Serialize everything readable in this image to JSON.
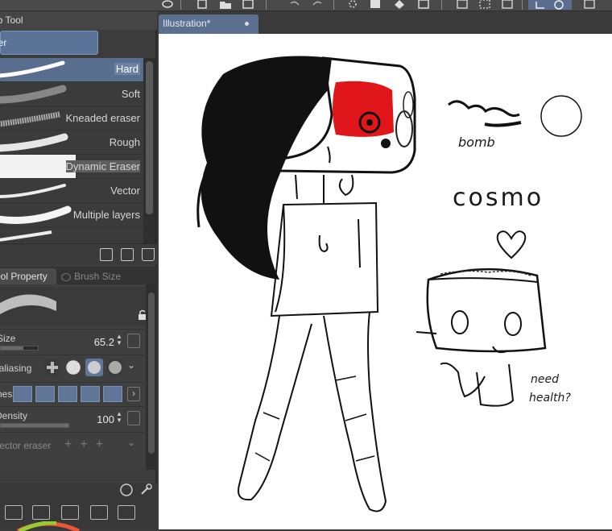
{
  "subtool_panel": {
    "title": "Sub Tool",
    "group_label": "Eraser",
    "brushes": [
      {
        "label": "Hard",
        "selected": true
      },
      {
        "label": "Soft",
        "selected": false
      },
      {
        "label": "Kneaded eraser",
        "selected": false
      },
      {
        "label": "Rough",
        "selected": false
      },
      {
        "label": "Dynamic Eraser",
        "selected": false
      },
      {
        "label": "Vector",
        "selected": false
      },
      {
        "label": "Multiple layers",
        "selected": false
      }
    ]
  },
  "property_tabs": {
    "tool_property": "Tool Property",
    "brush_size": "Brush Size"
  },
  "properties": {
    "size_label": "Size",
    "size_value": "65.2",
    "antialiasing_label": "Anti-aliasing",
    "hardness_label": "Hardness",
    "density_label": "Density",
    "density_value": "100",
    "vector_eraser_label": "Vector eraser"
  },
  "document": {
    "tab_title": "Illustration*"
  },
  "canvas_text": {
    "name": "cosmo",
    "need_line1": "need",
    "need_line2": "health?",
    "scribble": "bomb"
  },
  "colors": {
    "accent": "#5a7397",
    "canvas": "#ffffff",
    "paint_red": "#e0161a"
  }
}
